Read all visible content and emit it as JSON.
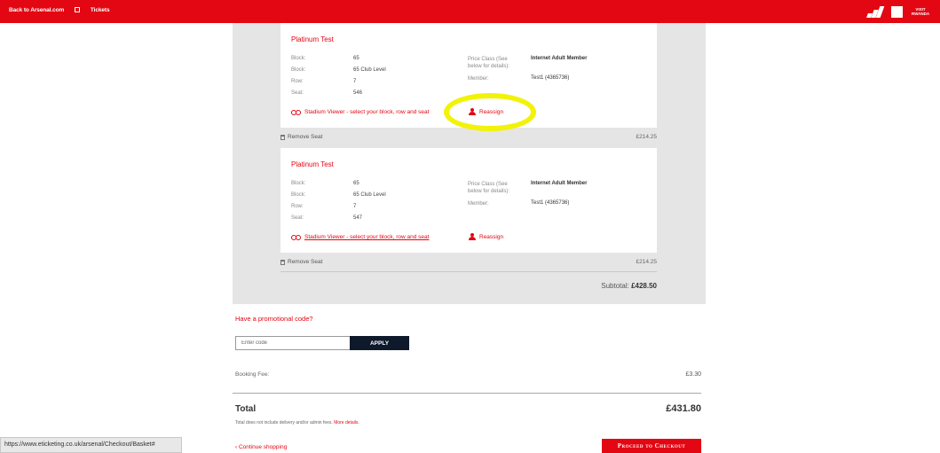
{
  "header": {
    "back_link": "Back to Arsenal.com",
    "tickets_link": "Tickets",
    "sponsors": {
      "adidas": "adidas",
      "emirates": "Emirates",
      "rwanda": [
        "VISIT",
        "RWANDA"
      ]
    }
  },
  "seats": [
    {
      "title": "Platinum Test",
      "details": [
        {
          "label": "Block:",
          "value": "65"
        },
        {
          "label": "Block:",
          "value": "65 Club Level"
        },
        {
          "label": "Row:",
          "value": "7"
        },
        {
          "label": "Seat:",
          "value": "546"
        }
      ],
      "price_class_label": "Price Class (See below for details):",
      "price_class_value": "Internet Adult Member",
      "member_label": "Member:",
      "member_value": "Test1 (4365736)",
      "viewer_link": "Stadium Viewer - select your block, row and seat",
      "reassign_label": "Reassign",
      "remove_label": "Remove Seat",
      "price": "£214.25"
    },
    {
      "title": "Platinum Test",
      "details": [
        {
          "label": "Block:",
          "value": "65"
        },
        {
          "label": "Block:",
          "value": "65 Club Level"
        },
        {
          "label": "Row:",
          "value": "7"
        },
        {
          "label": "Seat:",
          "value": "547"
        }
      ],
      "price_class_label": "Price Class (See below for details):",
      "price_class_value": "Internet Adult Member",
      "member_label": "Member:",
      "member_value": "Test1 (4365736)",
      "viewer_link": "Stadium Viewer - select your block, row and seat",
      "reassign_label": "Reassign",
      "remove_label": "Remove Seat",
      "price": "£214.25"
    }
  ],
  "subtotal": {
    "label": "Subtotal:",
    "value": "£428.50"
  },
  "promo": {
    "title": "Have a promotional code?",
    "placeholder": "Enter code",
    "button": "APPLY"
  },
  "booking_fee": {
    "label": "Booking Fee:",
    "value": "£3.30"
  },
  "total": {
    "label": "Total",
    "value": "£431.80",
    "note": "Total does not include delivery and/or admin fees.",
    "note_link": "More details."
  },
  "actions": {
    "continue": "‹ Continue shopping",
    "checkout": "Proceed to Checkout"
  },
  "status_url": "https://www.eticketing.co.uk/arsenal/Checkout/Basket#",
  "colors": {
    "brand_red": "#e30613",
    "highlight_yellow": "#f2f20a",
    "apply_navy": "#0e1a2b"
  }
}
